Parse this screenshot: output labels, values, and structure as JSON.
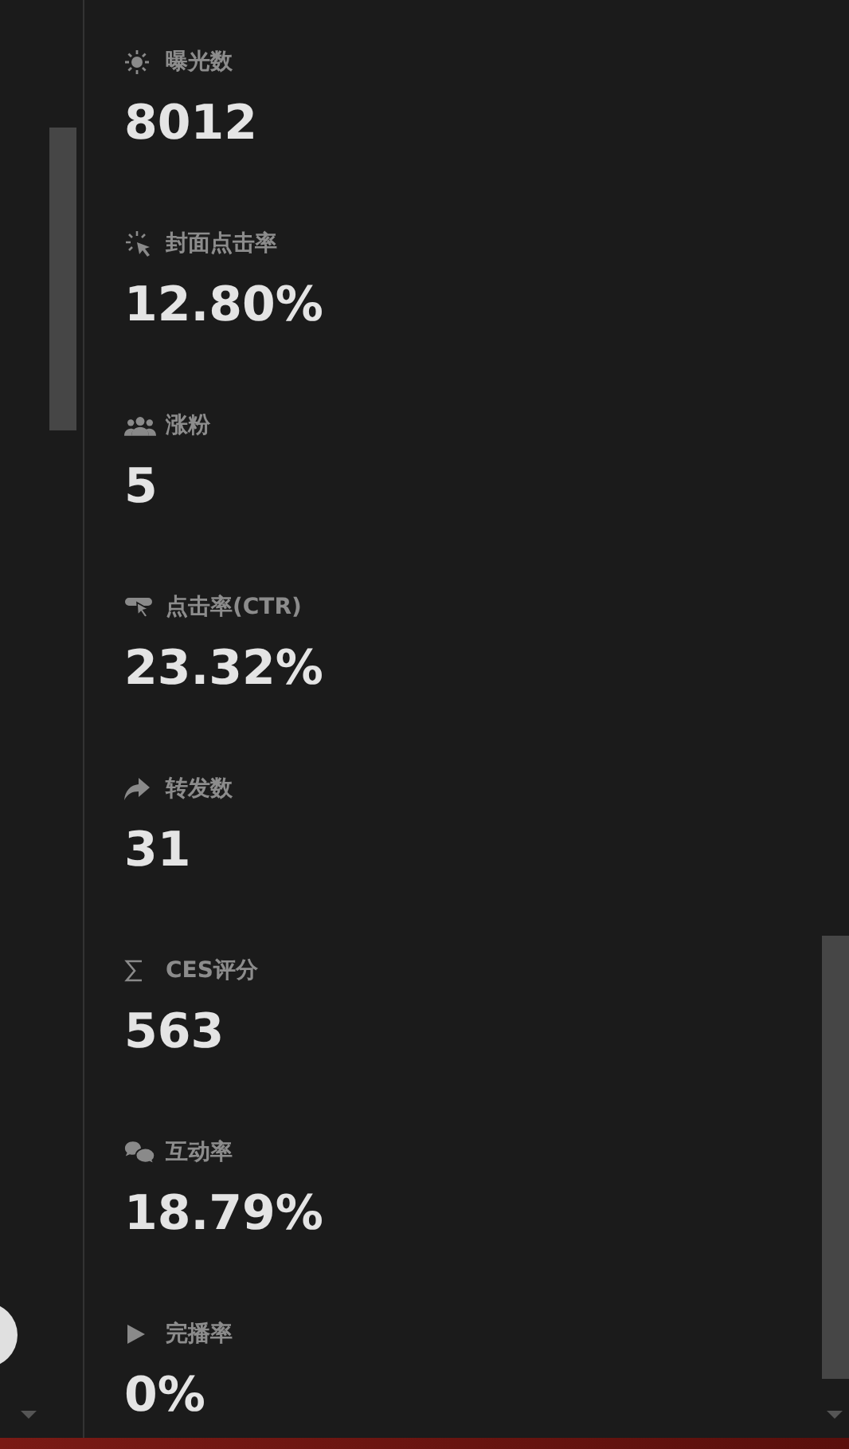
{
  "metrics": [
    {
      "label": "曝光数",
      "value": "8012"
    },
    {
      "label": "封面点击率",
      "value": "12.80%"
    },
    {
      "label": "涨粉",
      "value": "5"
    },
    {
      "label": "点击率(CTR)",
      "value": "23.32%"
    },
    {
      "label": "转发数",
      "value": "31"
    },
    {
      "label": "CES评分",
      "value": "563"
    },
    {
      "label": "互动率",
      "value": "18.79%"
    },
    {
      "label": "完播率",
      "value": "0%"
    }
  ]
}
